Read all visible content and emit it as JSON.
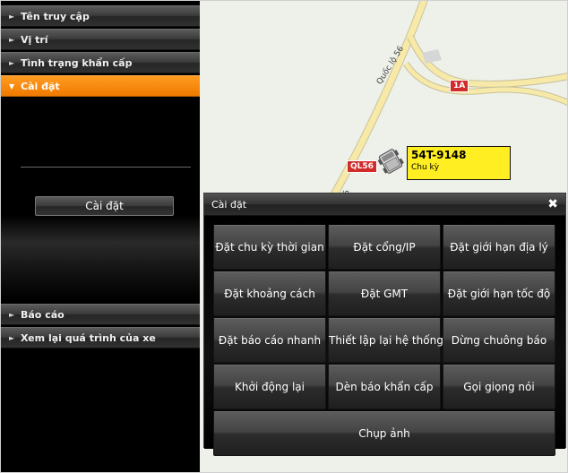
{
  "sidebar": {
    "top_headers": [
      {
        "label": "Tên truy cập"
      },
      {
        "label": "Vị trí"
      },
      {
        "label": "Tình trạng khẩn cấp"
      },
      {
        "label": "Cài đặt"
      }
    ],
    "panel_button": "Cài đặt",
    "bottom_headers": [
      {
        "label": "Báo cáo"
      },
      {
        "label": "Xem lại quá trình của xe"
      }
    ],
    "caret_collapsed": "►",
    "caret_expanded": "▼"
  },
  "map": {
    "road_name": "Quốc lộ 56",
    "road_number": "56",
    "route_badges": {
      "a": "1A",
      "b": "QL56"
    },
    "vehicle": {
      "plate": "54T-9148",
      "status": "Chu kỳ"
    }
  },
  "dialog": {
    "title": "Cài đặt",
    "close_icon": "✖",
    "buttons": [
      "Đặt chu kỳ thời gian",
      "Đặt cổng/IP",
      "Đặt giới hạn địa lý",
      "Đặt khoảng cách",
      "Đặt GMT",
      "Đặt giới hạn tốc độ",
      "Đặt báo cáo nhanh",
      "Thiết lập lại hệ thống",
      "Dừng chuông báo",
      "Khởi động lại",
      "Dèn báo khẩn cấp",
      "Gọi giọng nói",
      "Chụp ảnh"
    ]
  },
  "colors": {
    "accent": "#f08a10",
    "vehicle_label": "#ffee22",
    "route_badge": "#d22b2b",
    "map_background": "#eef0ea",
    "road": "#f7e9a8"
  }
}
